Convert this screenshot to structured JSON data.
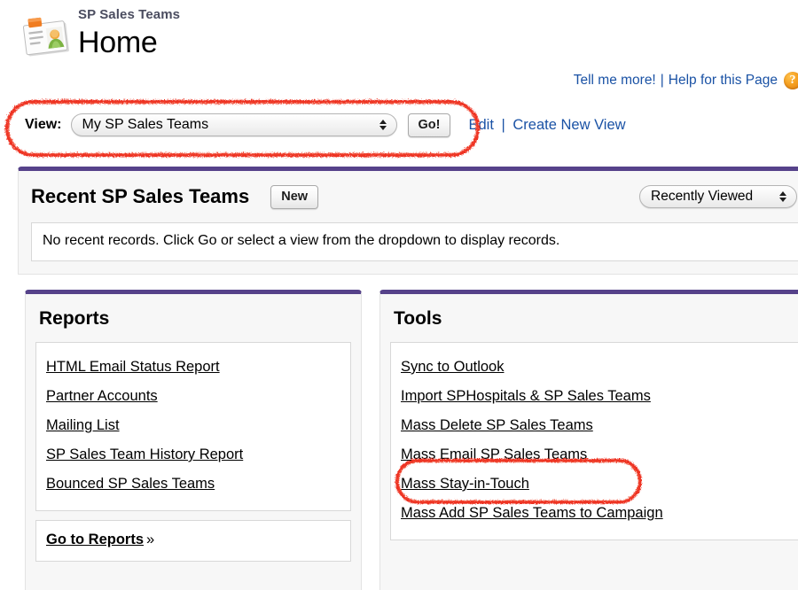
{
  "header": {
    "subtitle": "SP Sales Teams",
    "title": "Home",
    "icon": "contact-card-icon"
  },
  "help_links": {
    "tell_me_more": "Tell me more!",
    "separator": "|",
    "help_for_page": "Help for this Page",
    "help_icon_glyph": "?",
    "help_icon_name": "help-question-icon"
  },
  "view_filter": {
    "label": "View:",
    "selected_value": "My SP Sales Teams",
    "options": [
      "My SP Sales Teams"
    ],
    "go_button": "Go!",
    "edit_link": "Edit",
    "separator": "|",
    "create_new_view_link": "Create New View"
  },
  "recent_panel": {
    "title": "Recent SP Sales Teams",
    "new_button": "New",
    "filter_selected": "Recently Viewed",
    "filter_options": [
      "Recently Viewed"
    ],
    "empty_message": "No recent records. Click Go or select a view from the dropdown to display records."
  },
  "reports_panel": {
    "title": "Reports",
    "links": [
      "HTML Email Status Report",
      "Partner Accounts",
      "Mailing List",
      "SP Sales Team History Report",
      "Bounced SP Sales Teams"
    ],
    "footer_link": "Go to Reports",
    "footer_chevron": "»"
  },
  "tools_panel": {
    "title": "Tools",
    "links": [
      "Sync to Outlook",
      "Import SPHospitals & SP Sales Teams",
      "Mass Delete SP Sales Teams",
      "Mass Email SP Sales Teams",
      "Mass Stay-in-Touch",
      "Mass Add SP Sales Teams to Campaign"
    ]
  },
  "annotations": [
    {
      "name": "view-row-highlight",
      "shape": "rounded-rect",
      "target": "View: My SP Sales Teams Go!"
    },
    {
      "name": "mass-email-highlight",
      "shape": "ellipse",
      "target": "Mass Email SP Sales Teams"
    }
  ],
  "colors": {
    "accent_purple": "#56428a",
    "link_blue": "#1a52a5",
    "annotation_red": "#ee3322",
    "panel_bg": "#f7f7f7",
    "header_subtitle": "#4b4d60",
    "help_icon_orange": "#f5a021"
  }
}
